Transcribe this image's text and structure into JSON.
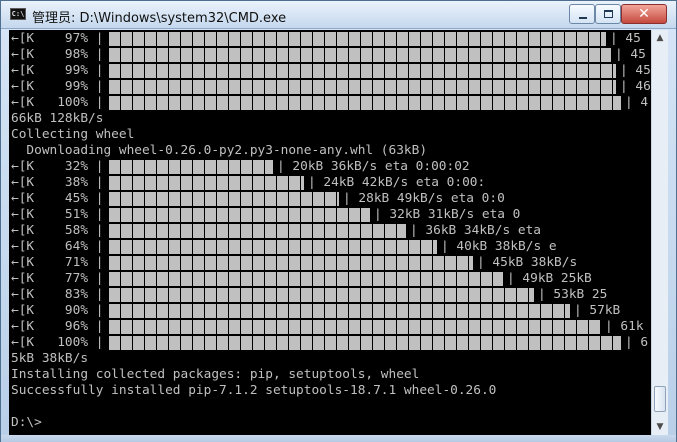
{
  "window": {
    "title": "管理员: D:\\Windows\\system32\\CMD.exe",
    "icon_text": "C:\\",
    "controls": {
      "minimize_label": "—",
      "maximize_label": "□",
      "close_label": "✕"
    }
  },
  "console": {
    "lines": [
      {
        "type": "progress",
        "prefix": "←[K    97% |",
        "progress": 0.97,
        "suffix": "| 45"
      },
      {
        "type": "progress",
        "prefix": "←[K    98% |",
        "progress": 0.98,
        "suffix": "| 45"
      },
      {
        "type": "progress",
        "prefix": "←[K    99% |",
        "progress": 0.99,
        "suffix": "| 45"
      },
      {
        "type": "progress",
        "prefix": "←[K    99% |",
        "progress": 0.99,
        "suffix": "| 46"
      },
      {
        "type": "progress",
        "prefix": "←[K   100% |",
        "progress": 1.0,
        "suffix": "| 4"
      },
      {
        "type": "text",
        "text": "66kB 128kB/s"
      },
      {
        "type": "text",
        "text": "Collecting wheel"
      },
      {
        "type": "text",
        "text": "  Downloading wheel-0.26.0-py2.py3-none-any.whl (63kB)"
      },
      {
        "type": "progress",
        "prefix": "←[K    32% |",
        "progress": 0.32,
        "suffix": "| 20kB 36kB/s eta 0:00:02"
      },
      {
        "type": "progress",
        "prefix": "←[K    38% |",
        "progress": 0.38,
        "suffix": "| 24kB 42kB/s eta 0:00:"
      },
      {
        "type": "progress",
        "prefix": "←[K    45% |",
        "progress": 0.45,
        "suffix": "| 28kB 49kB/s eta 0:0"
      },
      {
        "type": "progress",
        "prefix": "←[K    51% |",
        "progress": 0.51,
        "suffix": "| 32kB 31kB/s eta 0"
      },
      {
        "type": "progress",
        "prefix": "←[K    58% |",
        "progress": 0.58,
        "suffix": "| 36kB 34kB/s eta"
      },
      {
        "type": "progress",
        "prefix": "←[K    64% |",
        "progress": 0.64,
        "suffix": "| 40kB 38kB/s e"
      },
      {
        "type": "progress",
        "prefix": "←[K    71% |",
        "progress": 0.71,
        "suffix": "| 45kB 38kB/s"
      },
      {
        "type": "progress",
        "prefix": "←[K    77% |",
        "progress": 0.77,
        "suffix": "| 49kB 25kB"
      },
      {
        "type": "progress",
        "prefix": "←[K    83% |",
        "progress": 0.83,
        "suffix": "| 53kB 25"
      },
      {
        "type": "progress",
        "prefix": "←[K    90% |",
        "progress": 0.9,
        "suffix": "| 57kB"
      },
      {
        "type": "progress",
        "prefix": "←[K    96% |",
        "progress": 0.96,
        "suffix": "| 61k"
      },
      {
        "type": "progress",
        "prefix": "←[K   100% |",
        "progress": 1.0,
        "suffix": "| 6"
      },
      {
        "type": "text",
        "text": "5kB 38kB/s"
      },
      {
        "type": "text",
        "text": "Installing collected packages: pip, setuptools, wheel"
      },
      {
        "type": "text",
        "text": "Successfully installed pip-7.1.2 setuptools-18.7.1 wheel-0.26.0"
      },
      {
        "type": "text",
        "text": ""
      },
      {
        "type": "text",
        "text": "D:\\>"
      }
    ]
  },
  "colors": {
    "console_bg": "#000000",
    "console_fg": "#c0c0c0"
  },
  "icons": {
    "app": "cmd-icon",
    "minimize": "minimize-icon",
    "maximize": "maximize-icon",
    "close": "close-icon",
    "scroll_up": "scroll-up-arrow-icon",
    "scroll_down": "scroll-down-arrow-icon"
  }
}
